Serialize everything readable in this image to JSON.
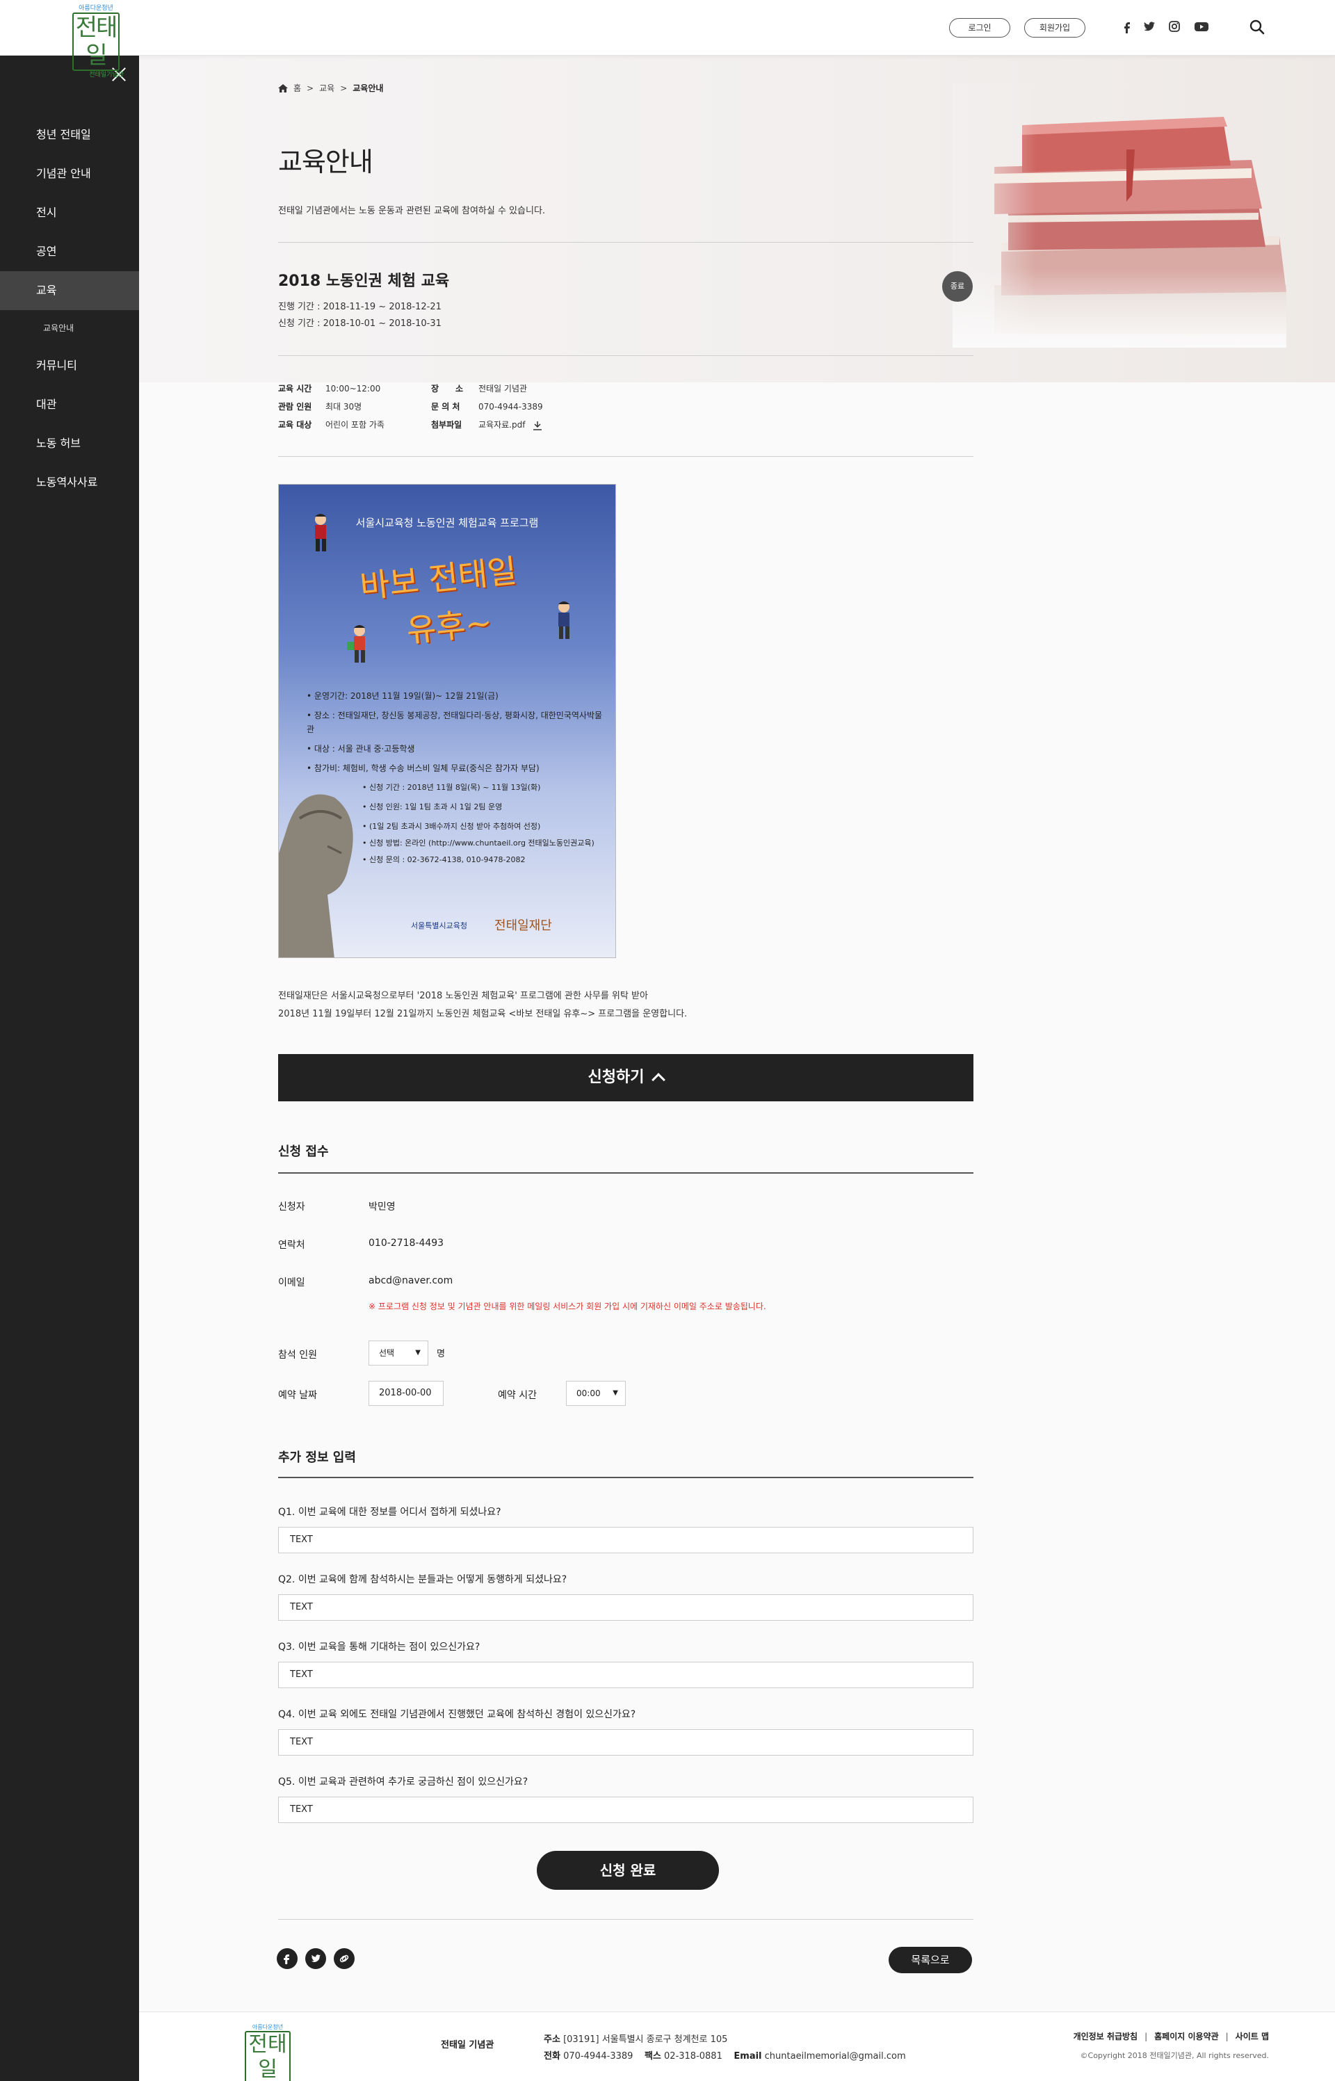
{
  "header": {
    "logo_top": "아름다운청년",
    "logo_main": "전태일",
    "logo_sub": "전태일기념관",
    "login": "로그인",
    "join": "회원가입",
    "social_icons": [
      "facebook-icon",
      "twitter-icon",
      "instagram-icon",
      "youtube-icon"
    ]
  },
  "sidebar": {
    "items": [
      {
        "label": "청년 전태일"
      },
      {
        "label": "기념관 안내"
      },
      {
        "label": "전시"
      },
      {
        "label": "공연"
      },
      {
        "label": "교육"
      },
      {
        "label": "교육안내"
      },
      {
        "label": "커뮤니티"
      },
      {
        "label": "대관"
      },
      {
        "label": "노동 허브"
      },
      {
        "label": "노동역사사료"
      }
    ]
  },
  "breadcrumb": {
    "home": "홈",
    "sep": ">",
    "level1": "교육",
    "current": "교육안내"
  },
  "page": {
    "title": "교육안내",
    "desc": "전태일 기념관에서는 노동 운동과 관련된 교육에 참여하실 수 있습니다."
  },
  "program": {
    "title": "2018 노동인권 체험 교육",
    "status": "종료",
    "period_run": "진행 기간 : 2018-11-19 ~ 2018-12-21",
    "period_apply": "신청 기간 : 2018-10-01 ~ 2018-10-31",
    "info": {
      "time_label": "교육 시간",
      "time": "10:00~12:00",
      "cap_label": "관람 인원",
      "cap": "최대 30명",
      "target_label": "교육 대상",
      "target": "어린이 포함 가족",
      "place_label": "장　　소",
      "place": "전태일 기념관",
      "contact_label": "문 의 처",
      "contact": "070-4944-3389",
      "file_label": "첨부파일",
      "file": "교육자료.pdf"
    }
  },
  "poster": {
    "title": "서울시교육청 노동인권 체험교육 프로그램",
    "big_line1": "바보 전태일",
    "big_line2": "유후~",
    "items": [
      "운영기간: 2018년 11월 19일(월)~ 12월 21일(금)",
      "장소 : 전태일재단, 창신동 봉제공장, 전태일다리·동상, 평화시장, 대한민국역사박물관",
      "대상 : 서울 관내 중·고등학생",
      "참가비: 체험비, 학생 수송 버스비 일체 무료(중식은 참가자 부담)"
    ],
    "sub_items": [
      "신청 기간 : 2018년 11월 8일(목) ~ 11월 13일(화)",
      "신청 인원: 1일 1팀 초과 시 1일 2팀 운영",
      "(1일 2팀 초과시 3배수까지 신청 받아 추첨하여 선정)",
      "신청 방법: 온라인 (http://www.chuntaeil.org 전태일노동인권교육)",
      "신청 문의 : 02-3672-4138, 010-9478-2082"
    ],
    "org1": "서울특별시교육청",
    "org2": "전태일재단"
  },
  "intro": {
    "line1": "전태일재단은 서울시교육청으로부터 '2018 노동인권 체험교육' 프로그램에 관한 사무를 위탁 받아",
    "line2": "2018년 11월 19일부터 12월 21일까지 노동인권 체험교육 <바보 전태일 유후~> 프로그램을 운영합니다."
  },
  "apply_button": "신청하기",
  "form": {
    "section_title": "신청 접수",
    "name_label": "신청자",
    "name": "박민영",
    "phone_label": "연락처",
    "phone": "010-2718-4493",
    "email_label": "이메일",
    "email": "abcd@naver.com",
    "notice": "※ 프로그램 신청 정보 및 기념관 안내를 위한 메일링 서비스가 회원 가입 시에 기재하신 이메일 주소로 발송됩니다.",
    "count_label": "참석 인원",
    "count_value": "선택",
    "count_unit": "명",
    "date_label": "예약 날짜",
    "date_value": "2018-00-00",
    "time_label": "예약 시간",
    "time_value": "00:00"
  },
  "extra": {
    "section_title": "추가 정보 입력",
    "questions": [
      {
        "q": "Q1. 이번 교육에 대한 정보를 어디서 접하게 되셨나요?",
        "a": "TEXT"
      },
      {
        "q": "Q2. 이번 교육에 함께 참석하시는 분들과는 어떻게 동행하게 되셨나요?",
        "a": "TEXT"
      },
      {
        "q": "Q3. 이번 교육을 통해 기대하는 점이 있으신가요?",
        "a": "TEXT"
      },
      {
        "q": "Q4. 이번 교육 외에도 전태일 기념관에서 진행했던 교육에 참석하신 경험이 있으신가요?",
        "a": "TEXT"
      },
      {
        "q": "Q5. 이번 교육과 관련하여 추가로 궁금하신 점이 있으신가요?",
        "a": "TEXT"
      }
    ]
  },
  "submit_button": "신청 완료",
  "list_button": "목록으로",
  "footer": {
    "name": "전태일 기념관",
    "addr_label": "주소",
    "addr": "[03191] 서울특별시 종로구 청계천로 105",
    "tel_label": "전화",
    "tel": "070-4944-3389",
    "fax_label": "팩스",
    "fax": "02-318-0881",
    "email_label": "Email",
    "email": "chuntaeilmemorial@gmail.com",
    "link1": "개인정보 취급방침",
    "link2": "홈페이지 이용약관",
    "link3": "사이트 맵",
    "copyright": "©Copyright 2018 전태일기념관, All rights reserved."
  }
}
